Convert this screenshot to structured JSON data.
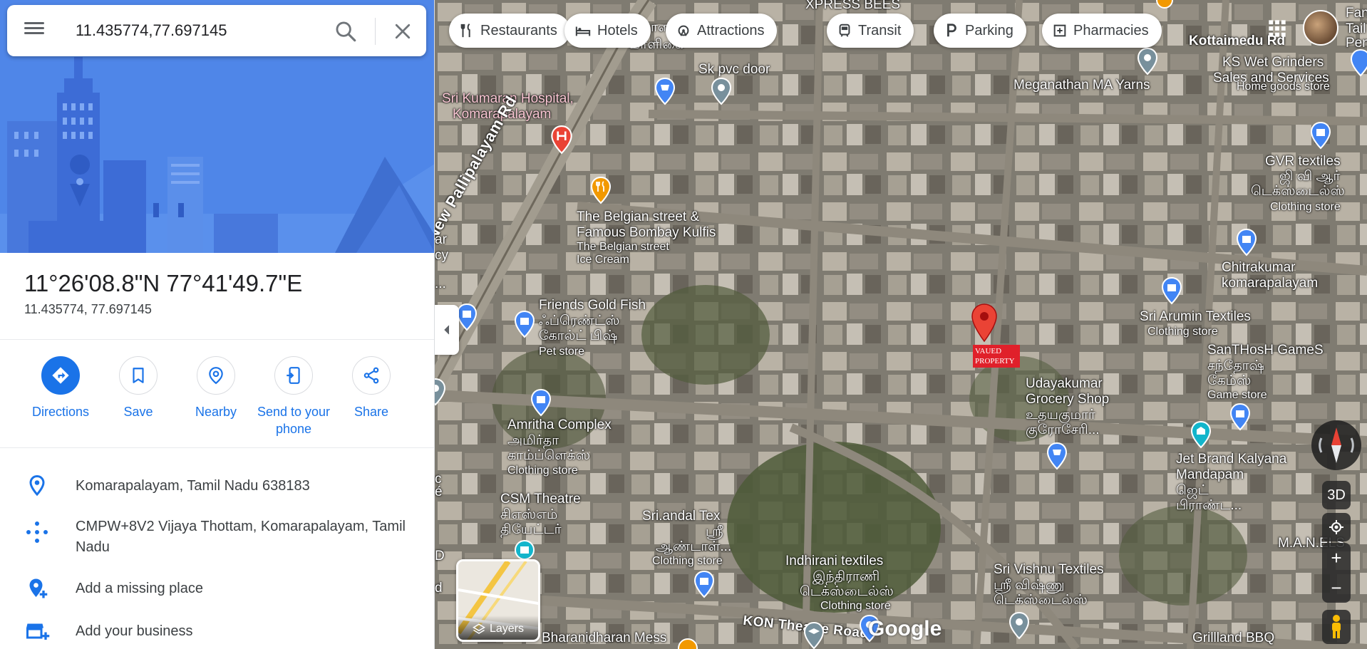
{
  "search": {
    "value": "11.435774,77.697145"
  },
  "place": {
    "dms": "11°26'08.8\"N 77°41'49.7\"E",
    "decimal": "11.435774, 77.697145"
  },
  "actions": [
    {
      "label": "Directions",
      "icon": "directions-icon"
    },
    {
      "label": "Save",
      "icon": "bookmark-icon"
    },
    {
      "label": "Nearby",
      "icon": "nearby-icon"
    },
    {
      "label": "Send to your phone",
      "icon": "send-to-phone-icon"
    },
    {
      "label": "Share",
      "icon": "share-icon"
    }
  ],
  "info": {
    "address": "Komarapalayam, Tamil Nadu 638183",
    "plus_code": "CMPW+8V2 Vijaya Thottam, Komarapalayam, Tamil Nadu",
    "add_place": "Add a missing place",
    "add_business": "Add your business"
  },
  "chips": [
    "Restaurants",
    "Hotels",
    "Attractions",
    "Transit",
    "Parking",
    "Pharmacies"
  ],
  "map_labels": {
    "xpress_bees": "XPRESS BEES",
    "kottaimedu": "Kottaimedu Rd",
    "fan": "Fan",
    "tail": "Tail",
    "pen": "Pen",
    "ks_wet_1": "KS Wet Grinders",
    "ks_wet_2": "Sales and Services",
    "ks_wet_sub": "Home goods store",
    "meganathan": "Meganathan MA Yarns",
    "tamil_kolantham": "கொளதம்",
    "tamil_maligai": "மாளிகை",
    "sk_pvc": "Sk pvc door",
    "sri_kumaran_1": "Sri Kumaran Hospital,",
    "sri_kumaran_2": "Komarapalayam",
    "gvr_1": "GVR textiles",
    "gvr_t1": "ஜி வி ஆர்",
    "gvr_t2": "டெக்ஸ்டைல்ஸ்",
    "gvr_sub": "Clothing store",
    "belgian_1": "The Belgian street &",
    "belgian_2": "Famous Bombay Kulfis",
    "belgian_s1": "The Belgian street",
    "belgian_s2": "Ice Cream",
    "new_pallipalayam": "New Pallipalayam Rd",
    "chitra_1": "Chitrakumar",
    "chitra_2": "komarapalayam",
    "friends_1": "Friends Gold Fish",
    "friends_t1": "ஃப்ரெண்ட்ஸ்",
    "friends_t2": "கோல்ட் பிஷ்",
    "friends_sub": "Pet store",
    "arumin_1": "Sri Arumin Textiles",
    "arumin_sub": "Clothing store",
    "santhosh_1": "SanTHosH GameS",
    "santhosh_t1": "சந்தோஷ்",
    "santhosh_t2": "கேம்ஸ்",
    "santhosh_sub": "Game store",
    "udaya_1": "Udayakumar",
    "udaya_2": "Grocery Shop",
    "udaya_t1": "உதயகுமார்",
    "udaya_t2": "குரோசேரி...",
    "amritha_1": "Amritha Complex",
    "amritha_t1": "அமிர்தா",
    "amritha_t2": "காம்ப்ளெக்ஸ்",
    "amritha_sub": "Clothing store",
    "jet_1": "Jet Brand Kalyana",
    "jet_2": "Mandapam",
    "jet_t1": "ஜெட்",
    "jet_t2": "பிராண்ட...",
    "csm_1": "CSM Theatre",
    "csm_t1": "சிஎஸ்எம்",
    "csm_t2": "தியேட்டர்",
    "andal_1": "Sri.andal Tex",
    "andal_t1": "ஸ்ரீ",
    "andal_t2": "ஆண்டாள்...",
    "andal_sub": "Clothing store",
    "manels": "M.A.N.ELS",
    "indhirani_1": "Indhirani textiles",
    "indhirani_t1": "இந்திராணி",
    "indhirani_t2": "டெக்ஸ்டைல்ஸ்",
    "indhirani_sub": "Clothing store",
    "vishnu_1": "Sri Vishnu Textiles",
    "vishnu_t1": "ஸ்ரீ விஷ்ணு",
    "vishnu_t2": "டெக்ஸ்டைல்ஸ்",
    "kon_road": "KON Theatre Road",
    "bharani": "Bharanidharan Mess",
    "grillland": "Grillland BBQ",
    "edge_ar": "ar",
    "edge_cy": "cy",
    "edge_dots": "...",
    "edge_c": "c",
    "edge_e": "é",
    "edge_d": "D",
    "edge_d2": "d",
    "tag_1": "VAUED",
    "tag_2": "PROPERTY"
  },
  "layers_label": "Layers",
  "google_logo": "Google",
  "controls": {
    "three_d": "3D",
    "zoom_in": "+",
    "zoom_out": "−"
  },
  "colors": {
    "accent": "#1a73e8",
    "hero": "#4f86e8",
    "pin_red": "#ea4335"
  }
}
